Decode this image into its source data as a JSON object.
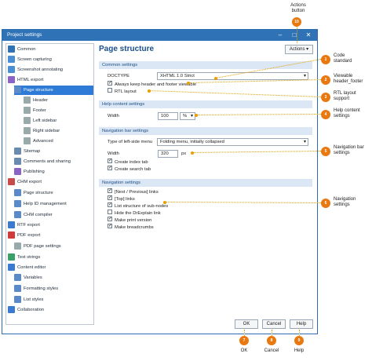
{
  "window": {
    "title": "Project settings"
  },
  "tree": [
    {
      "label": "Common",
      "icon": "gear-icon",
      "color": "#2f73b6"
    },
    {
      "label": "Screen capturing",
      "icon": "camera-icon",
      "color": "#4a8fd4"
    },
    {
      "label": "Screenshot annotating",
      "icon": "annotate-icon",
      "color": "#4a8fd4"
    },
    {
      "label": "HTML export",
      "icon": "html-icon",
      "color": "#8a64c4"
    },
    {
      "label": "Page structure",
      "icon": "page-icon",
      "color": "#5a8bc8",
      "selected": true
    },
    {
      "label": "Header",
      "icon": "layout-icon",
      "color": "#9aa"
    },
    {
      "label": "Footer",
      "icon": "layout-icon",
      "color": "#9aa"
    },
    {
      "label": "Left sidebar",
      "icon": "layout-icon",
      "color": "#9aa"
    },
    {
      "label": "Right sidebar",
      "icon": "layout-icon",
      "color": "#9aa"
    },
    {
      "label": "Advanced",
      "icon": "layout-icon",
      "color": "#9aa"
    },
    {
      "label": "Sitemap",
      "icon": "sitemap-icon",
      "color": "#6a8bb0"
    },
    {
      "label": "Comments and sharing",
      "icon": "comments-icon",
      "color": "#6a8bb0"
    },
    {
      "label": "Publishing",
      "icon": "publish-icon",
      "color": "#8a64c4"
    },
    {
      "label": "CHM export",
      "icon": "chm-icon",
      "color": "#c84a4a"
    },
    {
      "label": "Page structure",
      "icon": "page-icon",
      "color": "#5a8bc8"
    },
    {
      "label": "Help ID management",
      "icon": "id-icon",
      "color": "#5a8bc8"
    },
    {
      "label": "CHM compiler",
      "icon": "compiler-icon",
      "color": "#5a8bc8"
    },
    {
      "label": "RTF export",
      "icon": "rtf-icon",
      "color": "#3a7ad0"
    },
    {
      "label": "PDF export",
      "icon": "pdf-icon",
      "color": "#d03a3a"
    },
    {
      "label": "PDF page settings",
      "icon": "page-icon",
      "color": "#9aa"
    },
    {
      "label": "Text strings",
      "icon": "text-icon",
      "color": "#3aa06a"
    },
    {
      "label": "Content editor",
      "icon": "editor-icon",
      "color": "#3a7ad0"
    },
    {
      "label": "Variables",
      "icon": "variables-icon",
      "color": "#5a8bc8"
    },
    {
      "label": "Formatting styles",
      "icon": "styles-icon",
      "color": "#5a8bc8"
    },
    {
      "label": "List styles",
      "icon": "list-icon",
      "color": "#5a8bc8"
    },
    {
      "label": "Collaboration",
      "icon": "collab-icon",
      "color": "#3a7ad0"
    }
  ],
  "main": {
    "page_title": "Page structure",
    "actions_label": "Actions",
    "sections": {
      "common": "Common settings",
      "help": "Help content settings",
      "nav": "Navigation bar settings",
      "navigation": "Navigation settings"
    },
    "doctype_label": "DOCTYPE",
    "doctype_value": "XHTML 1.0 Strict",
    "keep_header": "Always keep header and footer viewable",
    "rtl": "RTL layout",
    "width_label": "Width",
    "width_value": "100",
    "width_unit": "%",
    "left_menu_label": "Type of left-side menu",
    "left_menu_value": "Folding menu, initially collapsed",
    "nav_width_label": "Width",
    "nav_width_value": "320",
    "nav_width_unit": "px",
    "create_index": "Create index tab",
    "create_search": "Create search tab",
    "nav_checks": [
      {
        "label": "[Next / Previous] links",
        "checked": true
      },
      {
        "label": "[Top] links",
        "checked": true
      },
      {
        "label": "List structure of sub-nodes",
        "checked": true
      },
      {
        "label": "Hide the DrExplain link",
        "checked": false
      },
      {
        "label": "Make print version",
        "checked": true
      },
      {
        "label": "Make breadcrumbs",
        "checked": true
      }
    ]
  },
  "buttons": {
    "ok": "OK",
    "cancel": "Cancel",
    "help": "Help"
  },
  "callouts": {
    "actions": {
      "num": "10",
      "text": "Actions\nbutton"
    },
    "code": {
      "num": "1",
      "text": "Code\nstandard"
    },
    "header": {
      "num": "2",
      "text": "Viewable\nheader_footer"
    },
    "rtl": {
      "num": "3",
      "text": "RTL layout\nsupport"
    },
    "help": {
      "num": "4",
      "text": "Help content\nsettings"
    },
    "navbar": {
      "num": "5",
      "text": "Navigation bar\nsettings"
    },
    "nav": {
      "num": "6",
      "text": "Navigation\nsettings"
    },
    "ok": {
      "num": "7",
      "text": "OK"
    },
    "cancel": {
      "num": "8",
      "text": "Cancel"
    },
    "helpbtn": {
      "num": "9",
      "text": "Help"
    }
  },
  "colors": {
    "accent": "#2f73b6",
    "callout": "#e8780f",
    "marker": "#e8a000"
  }
}
